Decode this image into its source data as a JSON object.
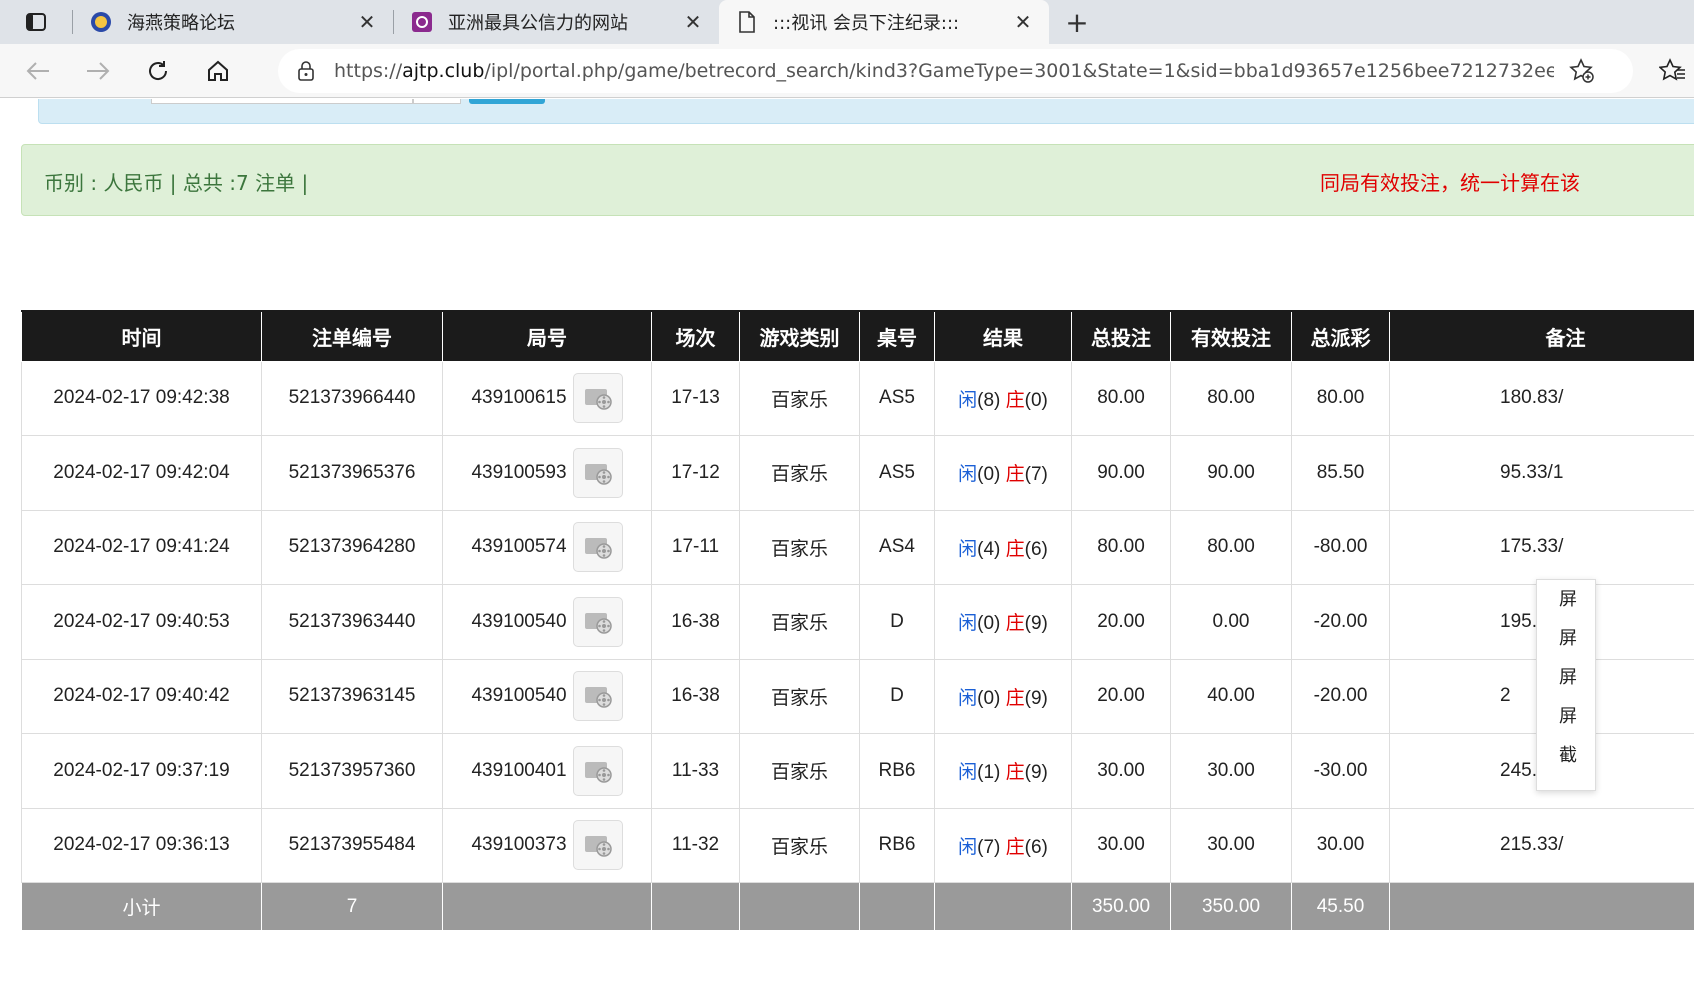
{
  "browser": {
    "tabs": [
      {
        "title": "海燕策略论坛",
        "active": false
      },
      {
        "title": "亚洲最具公信力的网站",
        "active": false
      },
      {
        "title": ":::视讯 会员下注纪录:::",
        "active": true
      }
    ],
    "url_prefix": "https://",
    "url_host": "ajtp.club",
    "url_rest": "/ipl/portal.php/game/betrecord_search/kind3?GameType=3001&State=1&sid=bba1d93657e1256bee7212732ee89..."
  },
  "summary": {
    "left": "币别 : 人民币 | 总共 :7 注单 |",
    "right": "同局有效投注，统一计算在该"
  },
  "table": {
    "headers": [
      "时间",
      "注单编号",
      "局号",
      "场次",
      "游戏类别",
      "桌号",
      "结果",
      "总投注",
      "有效投注",
      "总派彩",
      "备注"
    ],
    "player_label": "闲",
    "banker_label": "庄",
    "rows": [
      {
        "time": "2024-02-17 09:42:38",
        "bet_id": "521373966440",
        "round": "439100615",
        "shoe": "17-13",
        "game": "百家乐",
        "table": "AS5",
        "p": "(8)",
        "b": "(0)",
        "total": "80.00",
        "valid": "80.00",
        "payout": "80.00",
        "payout_neg": false,
        "note": "180.83/"
      },
      {
        "time": "2024-02-17 09:42:04",
        "bet_id": "521373965376",
        "round": "439100593",
        "shoe": "17-12",
        "game": "百家乐",
        "table": "AS5",
        "p": "(0)",
        "b": "(7)",
        "total": "90.00",
        "valid": "90.00",
        "payout": "85.50",
        "payout_neg": false,
        "note": "95.33/1"
      },
      {
        "time": "2024-02-17 09:41:24",
        "bet_id": "521373964280",
        "round": "439100574",
        "shoe": "17-11",
        "game": "百家乐",
        "table": "AS4",
        "p": "(4)",
        "b": "(6)",
        "total": "80.00",
        "valid": "80.00",
        "payout": "-80.00",
        "payout_neg": true,
        "note": "175.33/"
      },
      {
        "time": "2024-02-17 09:40:53",
        "bet_id": "521373963440",
        "round": "439100540",
        "shoe": "16-38",
        "game": "百家乐",
        "table": "D",
        "p": "(0)",
        "b": "(9)",
        "total": "20.00",
        "valid": "0.00",
        "payout": "-20.00",
        "payout_neg": true,
        "note": "195."
      },
      {
        "time": "2024-02-17 09:40:42",
        "bet_id": "521373963145",
        "round": "439100540",
        "shoe": "16-38",
        "game": "百家乐",
        "table": "D",
        "p": "(0)",
        "b": "(9)",
        "total": "20.00",
        "valid": "40.00",
        "payout": "-20.00",
        "payout_neg": true,
        "note": "2"
      },
      {
        "time": "2024-02-17 09:37:19",
        "bet_id": "521373957360",
        "round": "439100401",
        "shoe": "11-33",
        "game": "百家乐",
        "table": "RB6",
        "p": "(1)",
        "b": "(9)",
        "total": "30.00",
        "valid": "30.00",
        "payout": "-30.00",
        "payout_neg": true,
        "note": "245."
      },
      {
        "time": "2024-02-17 09:36:13",
        "bet_id": "521373955484",
        "round": "439100373",
        "shoe": "11-32",
        "game": "百家乐",
        "table": "RB6",
        "p": "(7)",
        "b": "(6)",
        "total": "30.00",
        "valid": "30.00",
        "payout": "30.00",
        "payout_neg": false,
        "note": "215.33/"
      }
    ],
    "subtotal": {
      "label": "小计",
      "count": "7",
      "total": "350.00",
      "valid": "350.00",
      "payout": "45.50"
    }
  },
  "popup_menu": [
    "屏",
    "屏",
    "屏",
    "屏",
    "截"
  ],
  "colors": {
    "header_bg": "#1b1b1b",
    "summary_bg": "#dff0d8",
    "blue": "#1a5fd6",
    "red": "#e00000",
    "subtotal_bg": "#9a9a9a"
  }
}
